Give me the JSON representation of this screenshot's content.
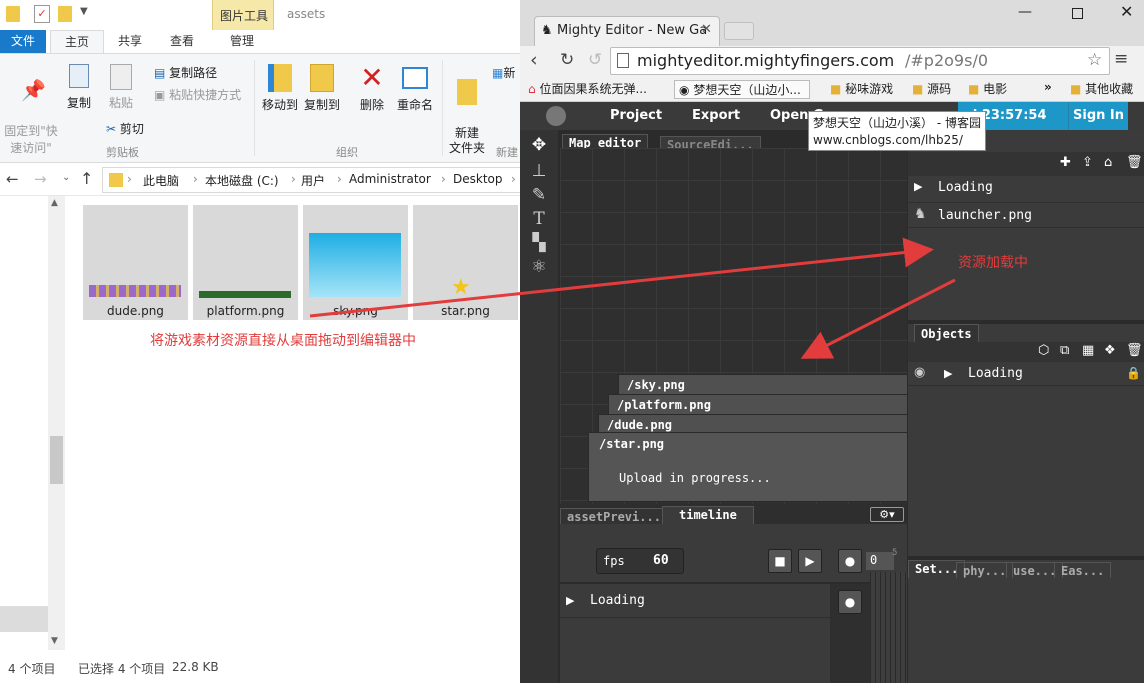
{
  "explorer": {
    "title_tabs": {
      "context": "图片工具",
      "folder": "assets"
    },
    "ribbon_tabs": [
      "文件",
      "主页",
      "共享",
      "查看",
      "管理"
    ],
    "clipboard": {
      "pin": "固定到\"快\n速访问\"",
      "copy": "复制",
      "paste": "粘贴",
      "copy_path": "复制路径",
      "paste_shortcut": "粘贴快捷方式",
      "cut": "剪切",
      "group": "剪贴板"
    },
    "organize": {
      "move_to": "移动到",
      "copy_to": "复制到",
      "delete": "删除",
      "rename": "重命名",
      "group": "组织"
    },
    "new": {
      "new_folder": "新建\n文件夹",
      "group": "新建",
      "partial": "新"
    },
    "breadcrumb": [
      "此电脑",
      "本地磁盘 (C:)",
      "用户",
      "Administrator",
      "Desktop"
    ],
    "files": [
      {
        "name": "dude.png"
      },
      {
        "name": "platform.png"
      },
      {
        "name": "sky.png"
      },
      {
        "name": "star.png"
      }
    ],
    "status": {
      "count": "4 个项目",
      "selected": "已选择 4 个项目",
      "size": "22.8 KB"
    },
    "annotation": "将游戏素材资源直接从桌面拖动到编辑器中"
  },
  "browser": {
    "tab_title": "Mighty Editor - New Ga",
    "url_host": "mightyeditor.mightyfingers.com",
    "url_path": "/#p2o9s/0",
    "bookmarks": [
      "位面因果系统无弹...",
      "梦想天空（山边小...",
      "秘味游戏",
      "源码",
      "电影",
      "»",
      "其他收藏"
    ],
    "tooltip_title": "梦想天空（山边小溪） - 博客园",
    "tooltip_url": "www.cnblogs.com/lhb25/"
  },
  "editor": {
    "menu": [
      "Project",
      "Export",
      "Open G"
    ],
    "clock": "d 23:57:54",
    "sign_in": "Sign In",
    "tabs": [
      "Map editor",
      "SourceEdi..."
    ],
    "assets": [
      "Loading",
      "launcher.png"
    ],
    "asset_annotation": "资源加载中",
    "objects_tab": "Objects",
    "objects_item": "Loading",
    "uploads": [
      "/sky.png",
      "/platform.png",
      "/dude.png",
      "/star.png"
    ],
    "upload_status": "Upload in progress...",
    "bottom_tabs": [
      "assetPrevi...",
      "timeline"
    ],
    "fps_label": "fps",
    "fps_value": "60",
    "frame_value": "0",
    "frame_mark": "5",
    "timeline_item": "Loading",
    "right_bottom_tabs": [
      "Set...",
      "phy...",
      "use...",
      "Eas..."
    ]
  }
}
